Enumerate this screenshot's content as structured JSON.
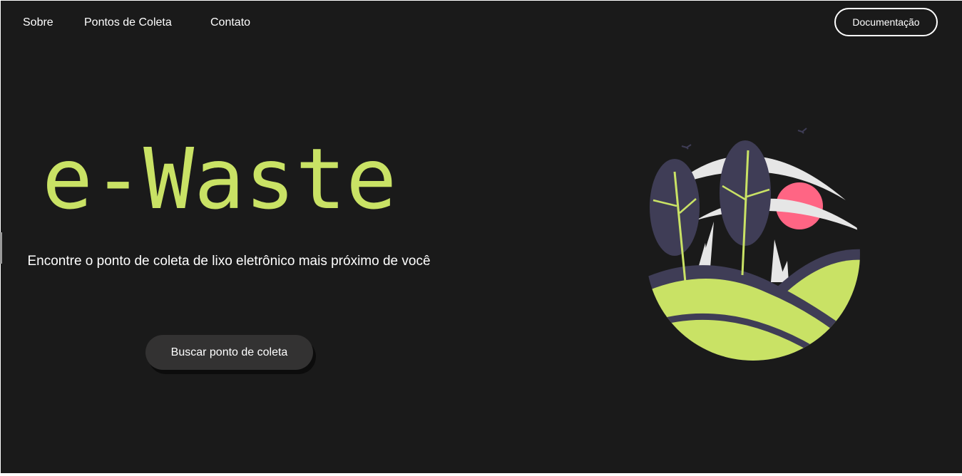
{
  "nav": {
    "links": [
      "Sobre",
      "Pontos de Coleta",
      "Contato"
    ],
    "doc_button": "Documentação"
  },
  "hero": {
    "title": "e-Waste",
    "subtitle": "Encontre o ponto de coleta de lixo eletrônico mais próximo de você",
    "cta": "Buscar ponto de coleta"
  },
  "colors": {
    "background": "#1a1a1a",
    "accent": "#c9e265",
    "sun": "#ff6584",
    "leaf": "#3f3d56",
    "button": "#333232"
  },
  "illustration": {
    "icon": "nature-landscape-illustration"
  }
}
